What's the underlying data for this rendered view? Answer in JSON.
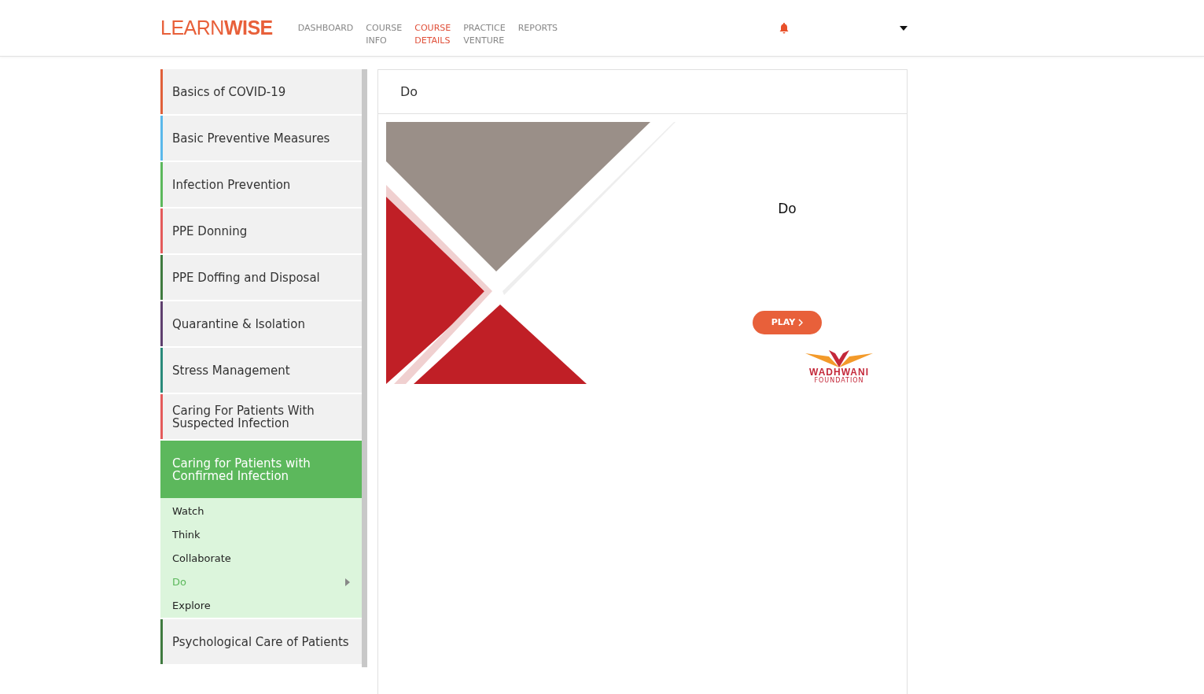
{
  "header": {
    "logo": {
      "light": "LEARN",
      "bold": "WISE"
    },
    "nav": [
      {
        "label": "DASHBOARD",
        "selected": false
      },
      {
        "label": "COURSE\nINFO",
        "selected": false
      },
      {
        "label": "COURSE\nDETAILS",
        "selected": true
      },
      {
        "label": "PRACTICE\nVENTURE",
        "selected": false
      },
      {
        "label": "REPORTS",
        "selected": false
      }
    ]
  },
  "sidebar": {
    "items": [
      {
        "title": "Basics of COVID-19",
        "color": "#e0603a",
        "selected": false
      },
      {
        "title": "Basic Preventive Measures",
        "color": "#5bb8ea",
        "selected": false
      },
      {
        "title": "Infection Prevention",
        "color": "#5cb85c",
        "selected": false
      },
      {
        "title": "PPE Donning",
        "color": "#e45b5b",
        "selected": false
      },
      {
        "title": "PPE Doffing and Disposal",
        "color": "#3f7a3f",
        "selected": false
      },
      {
        "title": "Quarantine & Isolation",
        "color": "#5e3f6e",
        "selected": false
      },
      {
        "title": "Stress Management",
        "color": "#2a8a7a",
        "selected": false
      },
      {
        "title": "Caring For Patients With\nSuspected Infection",
        "color": "#e45b5b",
        "selected": false
      },
      {
        "title": "Caring for Patients with\nConfirmed Infection",
        "color": "#5cb85c",
        "selected": true,
        "children": [
          {
            "label": "Watch",
            "selected": false
          },
          {
            "label": "Think",
            "selected": false
          },
          {
            "label": "Collaborate",
            "selected": false
          },
          {
            "label": "Do",
            "selected": true
          },
          {
            "label": "Explore",
            "selected": false
          }
        ]
      },
      {
        "title": "Psychological Care of Patients",
        "color": "#3f7a3f",
        "selected": false
      }
    ]
  },
  "panel": {
    "title": "Do",
    "banner": {
      "title": "Do",
      "button": "PLAY",
      "sponsor": {
        "name": "WADHWANI",
        "subtitle": "FOUNDATION"
      }
    }
  }
}
